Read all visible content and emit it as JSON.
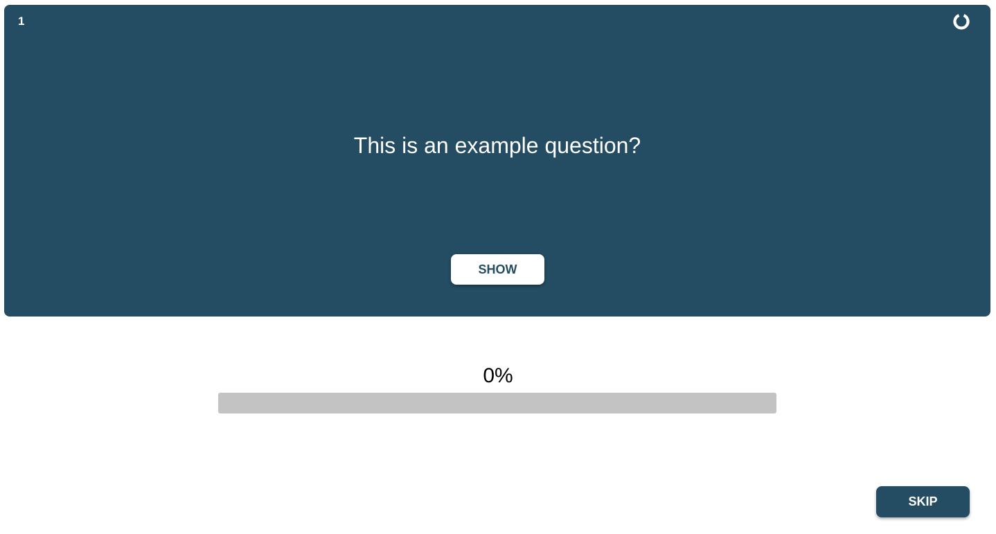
{
  "card": {
    "number": "1",
    "question": "This is an example question?",
    "show_label": "SHOW",
    "reset_icon": "reset-icon",
    "background_color": "#244c62"
  },
  "progress": {
    "label": "0%",
    "fraction": 0,
    "track_color": "#c3c3c3"
  },
  "footer": {
    "skip_label": "SKIP"
  }
}
